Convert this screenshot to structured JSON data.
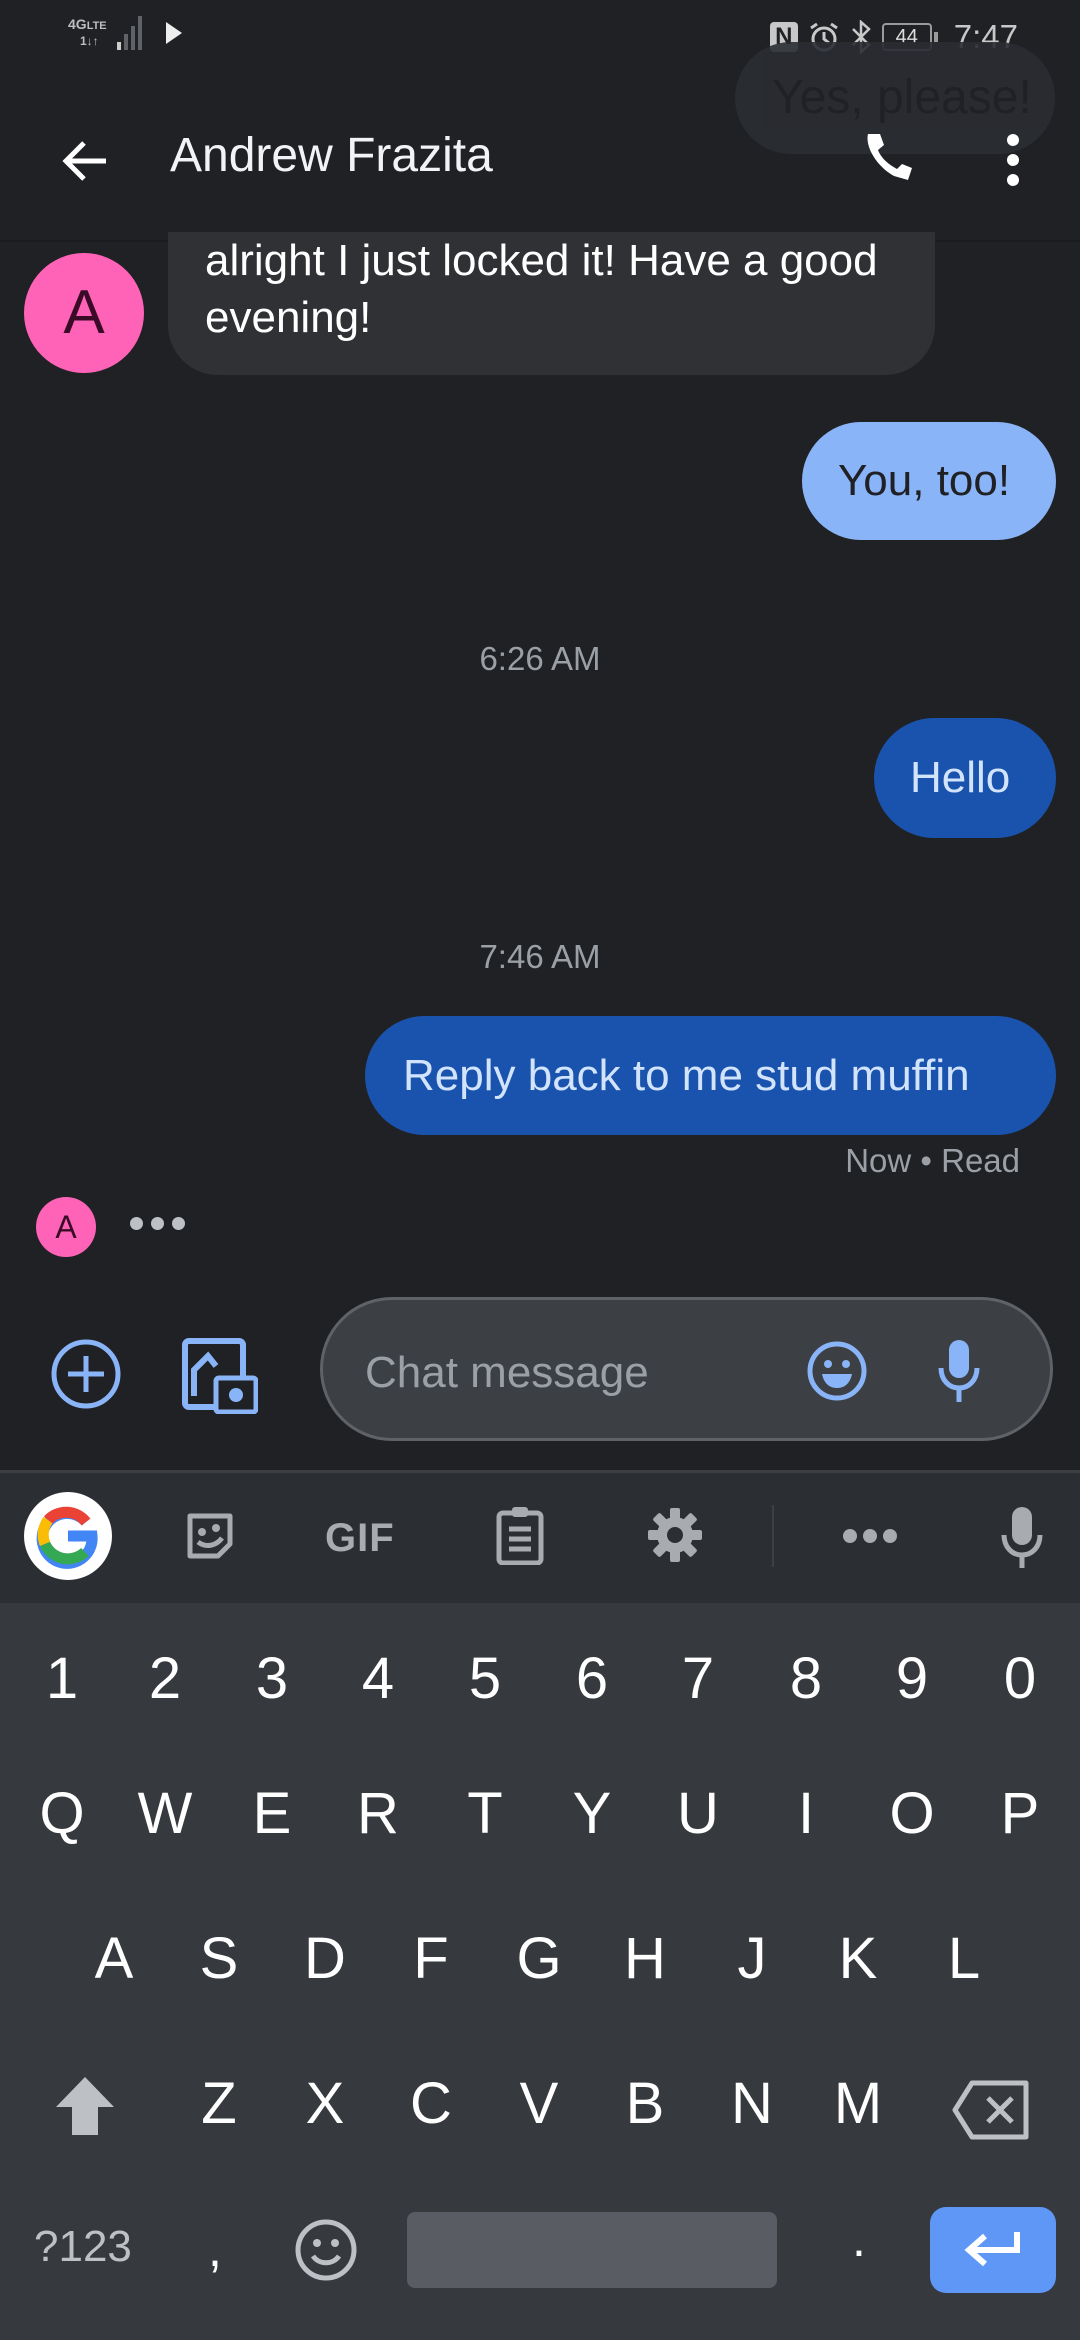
{
  "status_bar": {
    "network": "4G",
    "network_sup": "LTE",
    "network_sub": "1↓↑",
    "battery": "44",
    "time": "7:47",
    "icons": [
      "nfc-icon",
      "alarm-icon",
      "bluetooth-icon",
      "battery-icon",
      "play-store-notification-icon",
      "signal-icon"
    ]
  },
  "header": {
    "title": "Andrew Frazita",
    "back_icon": "arrow-back-icon",
    "call_icon": "phone-icon",
    "menu_icon": "more-vert-icon"
  },
  "ghost_bubble": {
    "text": "Yes, please!"
  },
  "contact": {
    "initial": "A",
    "avatar_color": "#ff63b8"
  },
  "messages": [
    {
      "direction": "received",
      "text": "alright I just locked it! Have a good evening!"
    },
    {
      "direction": "sent",
      "text": "You, too!"
    },
    {
      "type": "timestamp",
      "text": "6:26 AM"
    },
    {
      "direction": "sent",
      "text": "Hello"
    },
    {
      "type": "timestamp",
      "text": "7:46 AM"
    },
    {
      "direction": "sent",
      "text": "Reply back to me stud muffin",
      "meta": "Now • Read"
    }
  ],
  "typing_indicator": {
    "initial": "A"
  },
  "compose": {
    "placeholder": "Chat message",
    "attach_icon": "add-circle-icon",
    "gallery_icon": "gallery-camera-icon",
    "emoji_icon": "emoji-icon",
    "voice_icon": "mic-icon"
  },
  "keyboard": {
    "toolbar": {
      "items": [
        "google-icon",
        "sticker-icon",
        "GIF",
        "clipboard-icon",
        "settings-icon",
        "more-icon",
        "mic-icon"
      ]
    },
    "rows": [
      [
        "1",
        "2",
        "3",
        "4",
        "5",
        "6",
        "7",
        "8",
        "9",
        "0"
      ],
      [
        "Q",
        "W",
        "E",
        "R",
        "T",
        "Y",
        "U",
        "I",
        "O",
        "P"
      ],
      [
        "A",
        "S",
        "D",
        "F",
        "G",
        "H",
        "J",
        "K",
        "L"
      ],
      [
        "Z",
        "X",
        "C",
        "V",
        "B",
        "N",
        "M"
      ]
    ],
    "symbols_key": "?123",
    "comma_key": ",",
    "period_key": ".",
    "gif_label": "GIF"
  },
  "colors": {
    "background": "#202124",
    "sent_light": "#8ab4f8",
    "sent_dark": "#1a53ad",
    "received": "#303134",
    "accent_blue": "#8ab4f8",
    "enter_key": "#5e97f6"
  }
}
